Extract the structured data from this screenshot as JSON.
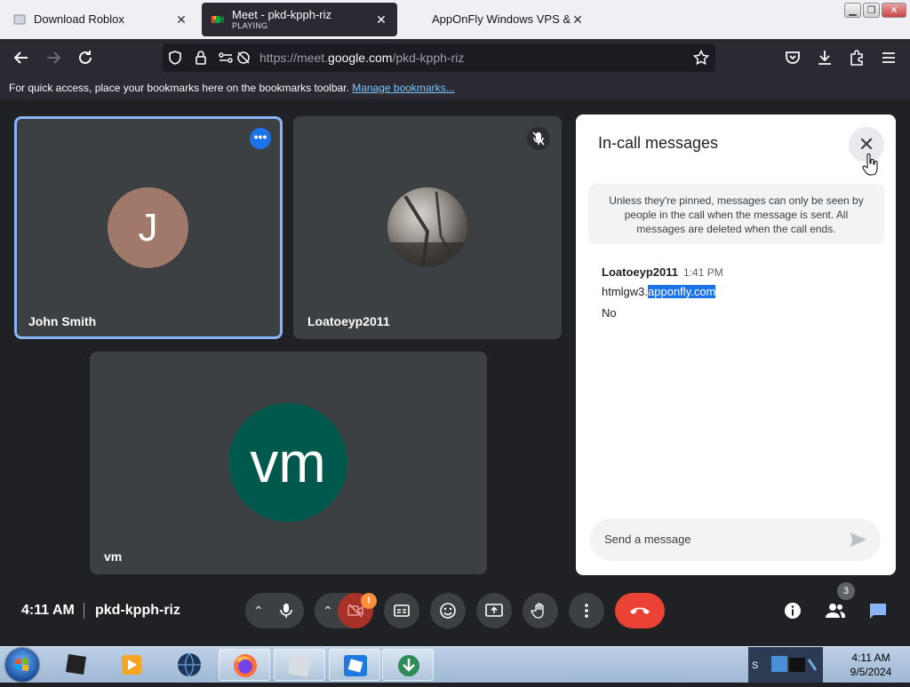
{
  "browser": {
    "tabs": [
      {
        "title": "Download Roblox",
        "sub": "",
        "active": false
      },
      {
        "title": "Meet - pkd-kpph-riz",
        "sub": "PLAYING",
        "active": true
      },
      {
        "title": "AppOnFly Windows VPS & Clo",
        "sub": "",
        "active": false
      }
    ],
    "url_prefix": "https://meet.",
    "url_domain": "google.com",
    "url_path": "/pkd-kpph-riz",
    "bookmarks_text": "For quick access, place your bookmarks here on the bookmarks toolbar.",
    "bookmarks_link": "Manage bookmarks..."
  },
  "participants": [
    {
      "name": "John Smith",
      "initial": "J",
      "avatar_color": "#a1796a"
    },
    {
      "name": "Loatoeyp2011"
    },
    {
      "name": "vm",
      "initial": "vm",
      "avatar_color": "#00594c"
    }
  ],
  "chat": {
    "title": "In-call messages",
    "info": "Unless they're pinned, messages can only be seen by people in the call when the message is sent. All messages are deleted when the call ends.",
    "sender": "Loatoeyp2011",
    "time": "1:41 PM",
    "msg1_prefix": "htmlgw3.",
    "msg1_selected": "apponfly.com",
    "msg2": "No",
    "input_placeholder": "Send a message"
  },
  "bottom": {
    "time": "4:11 AM",
    "meeting_code": "pkd-kpph-riz",
    "camera_badge": "!",
    "people_count": "3"
  },
  "taskbar": {
    "time": "4:11 AM",
    "date": "9/5/2024"
  }
}
